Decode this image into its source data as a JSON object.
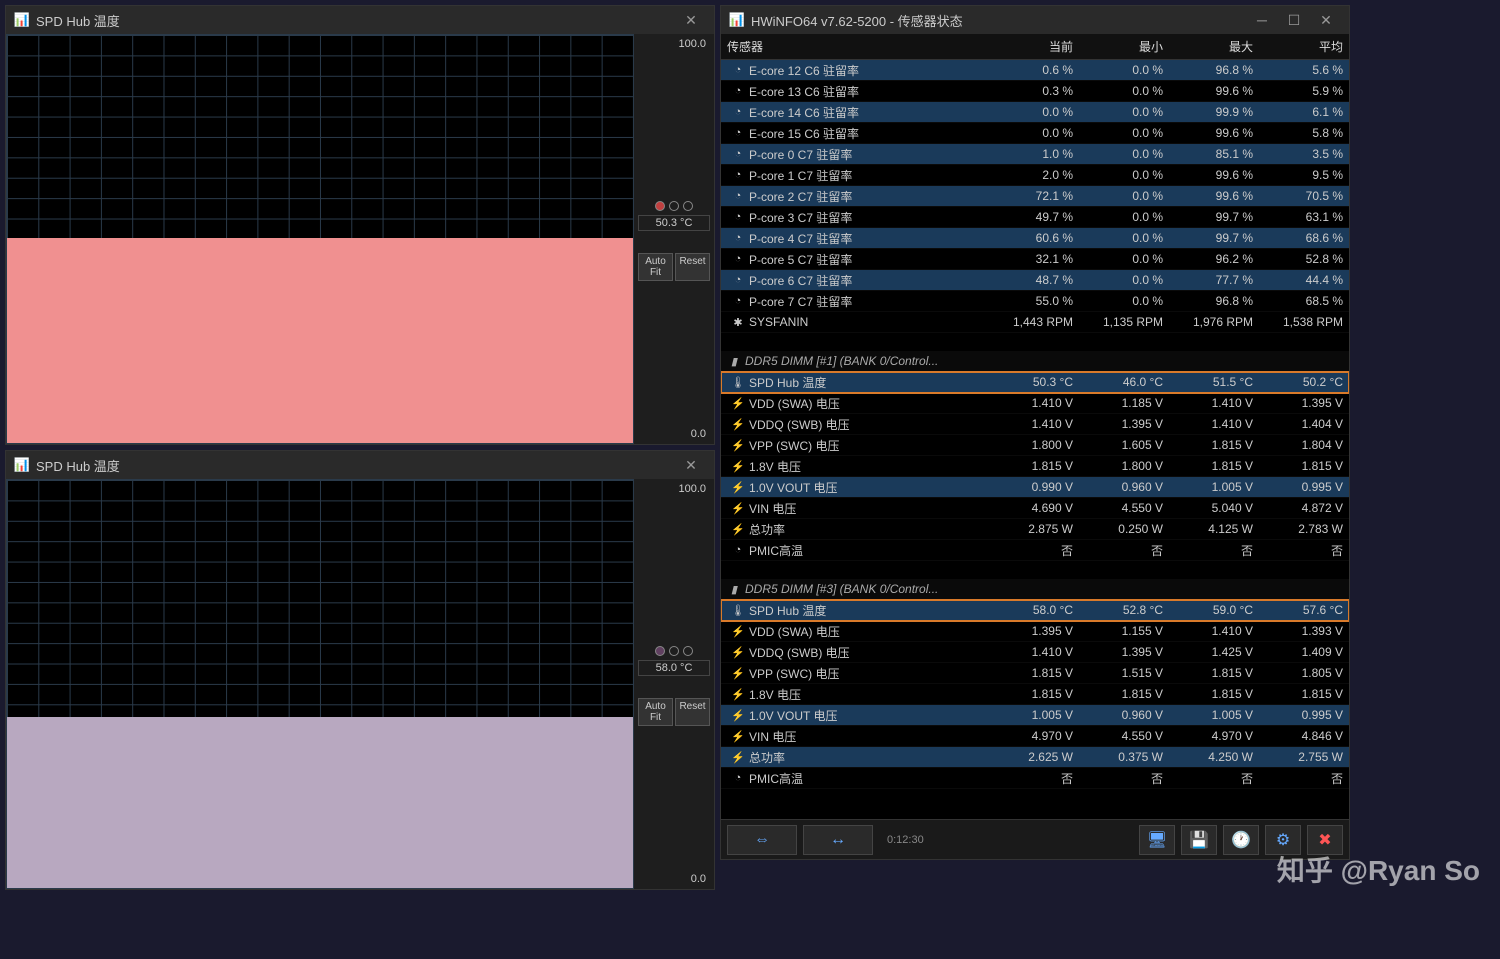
{
  "graph1": {
    "title": "SPD Hub 温度",
    "scale_max": "100.0",
    "scale_min": "0.0",
    "current": "50.3 °C",
    "auto_fit": "Auto Fit",
    "reset": "Reset",
    "fill_color": "#f09090",
    "fill_pct": 50.3,
    "dot_color": "#c04040"
  },
  "graph2": {
    "title": "SPD Hub 温度",
    "scale_max": "100.0",
    "scale_min": "0.0",
    "current": "58.0 °C",
    "auto_fit": "Auto Fit",
    "reset": "Reset",
    "fill_color": "#b8a8c0",
    "fill_pct": 42,
    "dot_color": "#604060"
  },
  "hwinfo": {
    "title": "HWiNFO64 v7.62-5200 - 传感器状态",
    "headers": {
      "name": "传感器",
      "cur": "当前",
      "min": "最小",
      "max": "最大",
      "avg": "平均"
    },
    "timer": "0:12:30",
    "rows": [
      {
        "icon": "clock",
        "name": "E-core 12 C6 驻留率",
        "cur": "0.6 %",
        "min": "0.0 %",
        "max": "96.8 %",
        "avg": "5.6 %",
        "hl": true
      },
      {
        "icon": "clock",
        "name": "E-core 13 C6 驻留率",
        "cur": "0.3 %",
        "min": "0.0 %",
        "max": "99.6 %",
        "avg": "5.9 %"
      },
      {
        "icon": "clock",
        "name": "E-core 14 C6 驻留率",
        "cur": "0.0 %",
        "min": "0.0 %",
        "max": "99.9 %",
        "avg": "6.1 %",
        "hl": true
      },
      {
        "icon": "clock",
        "name": "E-core 15 C6 驻留率",
        "cur": "0.0 %",
        "min": "0.0 %",
        "max": "99.6 %",
        "avg": "5.8 %"
      },
      {
        "icon": "clock",
        "name": "P-core 0 C7 驻留率",
        "cur": "1.0 %",
        "min": "0.0 %",
        "max": "85.1 %",
        "avg": "3.5 %",
        "hl": true
      },
      {
        "icon": "clock",
        "name": "P-core 1 C7 驻留率",
        "cur": "2.0 %",
        "min": "0.0 %",
        "max": "99.6 %",
        "avg": "9.5 %"
      },
      {
        "icon": "clock",
        "name": "P-core 2 C7 驻留率",
        "cur": "72.1 %",
        "min": "0.0 %",
        "max": "99.6 %",
        "avg": "70.5 %",
        "hl": true
      },
      {
        "icon": "clock",
        "name": "P-core 3 C7 驻留率",
        "cur": "49.7 %",
        "min": "0.0 %",
        "max": "99.7 %",
        "avg": "63.1 %"
      },
      {
        "icon": "clock",
        "name": "P-core 4 C7 驻留率",
        "cur": "60.6 %",
        "min": "0.0 %",
        "max": "99.7 %",
        "avg": "68.6 %",
        "hl": true
      },
      {
        "icon": "clock",
        "name": "P-core 5 C7 驻留率",
        "cur": "32.1 %",
        "min": "0.0 %",
        "max": "96.2 %",
        "avg": "52.8 %"
      },
      {
        "icon": "clock",
        "name": "P-core 6 C7 驻留率",
        "cur": "48.7 %",
        "min": "0.0 %",
        "max": "77.7 %",
        "avg": "44.4 %",
        "hl": true
      },
      {
        "icon": "clock",
        "name": "P-core 7 C7 驻留率",
        "cur": "55.0 %",
        "min": "0.0 %",
        "max": "96.8 %",
        "avg": "68.5 %"
      },
      {
        "icon": "fan",
        "name": "SYSFANIN",
        "cur": "1,443 RPM",
        "min": "1,135 RPM",
        "max": "1,976 RPM",
        "avg": "1,538 RPM"
      },
      {
        "spacer": true
      },
      {
        "group": true,
        "icon": "dimm",
        "name": "DDR5 DIMM [#1] (BANK 0/Control..."
      },
      {
        "icon": "temp",
        "name": "SPD Hub 温度",
        "cur": "50.3 °C",
        "min": "46.0 °C",
        "max": "51.5 °C",
        "avg": "50.2 °C",
        "hl": true,
        "boxed": true
      },
      {
        "icon": "volt",
        "name": "VDD (SWA) 电压",
        "cur": "1.410 V",
        "min": "1.185 V",
        "max": "1.410 V",
        "avg": "1.395 V"
      },
      {
        "icon": "volt",
        "name": "VDDQ (SWB) 电压",
        "cur": "1.410 V",
        "min": "1.395 V",
        "max": "1.410 V",
        "avg": "1.404 V"
      },
      {
        "icon": "volt",
        "name": "VPP (SWC) 电压",
        "cur": "1.800 V",
        "min": "1.605 V",
        "max": "1.815 V",
        "avg": "1.804 V"
      },
      {
        "icon": "volt",
        "name": "1.8V 电压",
        "cur": "1.815 V",
        "min": "1.800 V",
        "max": "1.815 V",
        "avg": "1.815 V"
      },
      {
        "icon": "volt",
        "name": "1.0V VOUT 电压",
        "cur": "0.990 V",
        "min": "0.960 V",
        "max": "1.005 V",
        "avg": "0.995 V",
        "hl": true
      },
      {
        "icon": "volt",
        "name": "VIN 电压",
        "cur": "4.690 V",
        "min": "4.550 V",
        "max": "5.040 V",
        "avg": "4.872 V"
      },
      {
        "icon": "power",
        "name": "总功率",
        "cur": "2.875 W",
        "min": "0.250 W",
        "max": "4.125 W",
        "avg": "2.783 W"
      },
      {
        "icon": "clock",
        "name": "PMIC高温",
        "cur": "否",
        "min": "否",
        "max": "否",
        "avg": "否"
      },
      {
        "spacer": true
      },
      {
        "group": true,
        "icon": "dimm",
        "name": "DDR5 DIMM [#3] (BANK 0/Control..."
      },
      {
        "icon": "temp",
        "name": "SPD Hub 温度",
        "cur": "58.0 °C",
        "min": "52.8 °C",
        "max": "59.0 °C",
        "avg": "57.6 °C",
        "hl": true,
        "boxed": true
      },
      {
        "icon": "volt",
        "name": "VDD (SWA) 电压",
        "cur": "1.395 V",
        "min": "1.155 V",
        "max": "1.410 V",
        "avg": "1.393 V"
      },
      {
        "icon": "volt",
        "name": "VDDQ (SWB) 电压",
        "cur": "1.410 V",
        "min": "1.395 V",
        "max": "1.425 V",
        "avg": "1.409 V"
      },
      {
        "icon": "volt",
        "name": "VPP (SWC) 电压",
        "cur": "1.815 V",
        "min": "1.515 V",
        "max": "1.815 V",
        "avg": "1.805 V"
      },
      {
        "icon": "volt",
        "name": "1.8V 电压",
        "cur": "1.815 V",
        "min": "1.815 V",
        "max": "1.815 V",
        "avg": "1.815 V"
      },
      {
        "icon": "volt",
        "name": "1.0V VOUT 电压",
        "cur": "1.005 V",
        "min": "0.960 V",
        "max": "1.005 V",
        "avg": "0.995 V",
        "hl": true
      },
      {
        "icon": "volt",
        "name": "VIN 电压",
        "cur": "4.970 V",
        "min": "4.550 V",
        "max": "4.970 V",
        "avg": "4.846 V"
      },
      {
        "icon": "power",
        "name": "总功率",
        "cur": "2.625 W",
        "min": "0.375 W",
        "max": "4.250 W",
        "avg": "2.755 W",
        "hl": true
      },
      {
        "icon": "clock",
        "name": "PMIC高温",
        "cur": "否",
        "min": "否",
        "max": "否",
        "avg": "否"
      }
    ]
  },
  "icons": {
    "clock": "◔",
    "fan": "✱",
    "dimm": "▮",
    "temp": "🌡",
    "volt": "⚡",
    "power": "⚡"
  },
  "watermark": "知乎 @Ryan So"
}
